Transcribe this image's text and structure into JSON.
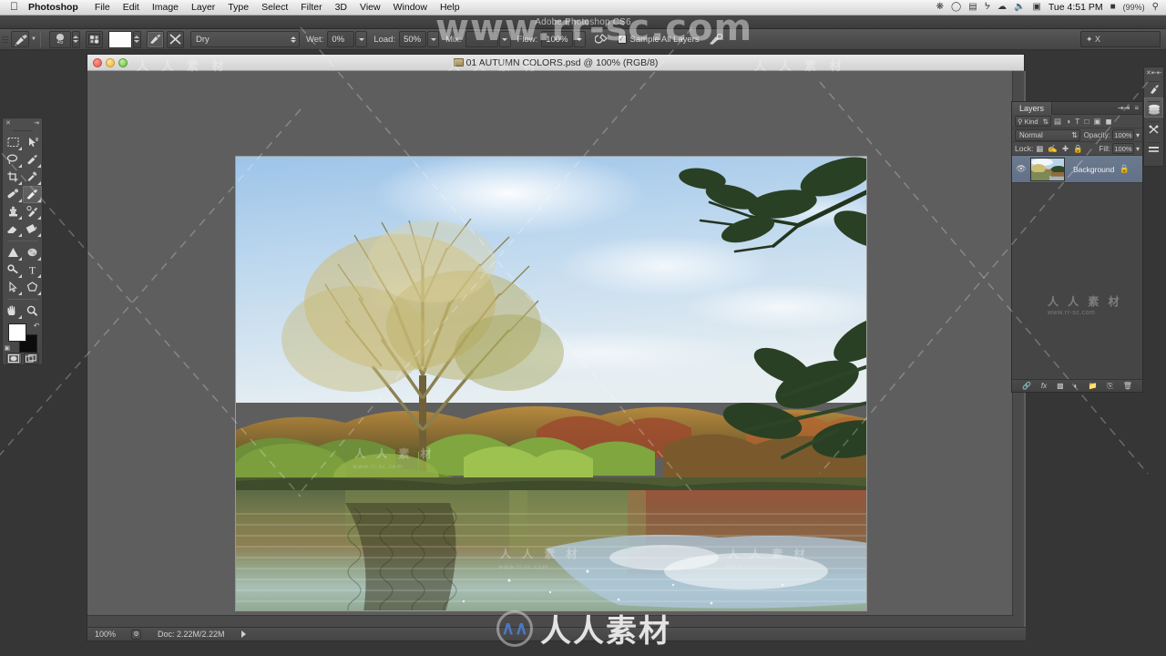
{
  "os_menubar": {
    "apple_icon": "apple-icon",
    "app_name": "Photoshop",
    "menus": [
      "File",
      "Edit",
      "Image",
      "Layer",
      "Type",
      "Select",
      "Filter",
      "3D",
      "View",
      "Window",
      "Help"
    ],
    "status_icons": [
      "spinner-icon",
      "clock-icon",
      "display-icon",
      "bluetooth-icon",
      "wifi-icon",
      "volume-icon",
      "airplay-icon"
    ],
    "clock": "Tue 4:51 PM",
    "battery": "(99%)",
    "search_icon": "search-icon"
  },
  "app": {
    "title": "Adobe Photoshop CS6"
  },
  "options_bar": {
    "tool_preset_icon": "mixer-brush-icon",
    "brush_size_label": "45",
    "brush_preset_icon": "brush-preset-icon",
    "load_swatch_color": "#fdfdfd",
    "clean_brush_icon": "clean-brush-icon",
    "load_brush_icon": "load-brush-icon",
    "preset_combo": "Dry",
    "wet_label": "Wet:",
    "wet_value": "0%",
    "load_label": "Load:",
    "load_value": "50%",
    "mix_label": "Mix:",
    "mix_value": "",
    "flow_label": "Flow:",
    "flow_value": "100%",
    "airbrush_icon": "airbrush-icon",
    "sample_all_layers_label": "Sample All Layers",
    "sample_all_layers_checked": "✓",
    "pressure_icon": "pressure-icon",
    "workspace_value": "✦ X"
  },
  "tools": {
    "column_left": [
      "marquee-rect-icon",
      "lasso-icon",
      "crop-icon",
      "eyedropper-icon",
      "clone-stamp-icon",
      "eraser-icon",
      "gradient-icon",
      "blur-icon",
      "path-selection-icon",
      "hand-icon"
    ],
    "column_right": [
      "move-icon",
      "quick-selection-icon",
      "healing-brush-icon",
      "mixer-brush-icon",
      "history-brush-icon",
      "paint-bucket-icon",
      "dodge-icon",
      "type-icon",
      "shape-icon",
      "zoom-icon"
    ],
    "selected": "mixer-brush-icon",
    "foreground_color": "#ffffff",
    "background_color": "#0c0c0c",
    "swap_icon": "swap-colors-icon",
    "default_icon": "default-colors-icon",
    "quickmask_icons": [
      "standard-mode-icon",
      "screen-mode-icon"
    ]
  },
  "document": {
    "title": "01 AUTUMN COLORS.psd @ 100% (RGB/8)",
    "file_icon": "psd-file-icon",
    "window_buttons": [
      "close-button",
      "minimize-button",
      "zoom-button"
    ],
    "status": {
      "zoom": "100%",
      "doc_label": "Doc: 2.22M/2.22M",
      "play_icon": "status-arrow-icon"
    }
  },
  "layers_panel": {
    "tab_label": "Layers",
    "collapse_icon": "collapse-icon",
    "menu_icon": "panel-menu-icon",
    "filter_label": "Kind",
    "filter_icon": "filter-kind-icon",
    "filter_type_icons": [
      "pixel-filter-icon",
      "adjustment-filter-icon",
      "type-filter-icon",
      "shape-filter-icon",
      "smartobject-filter-icon"
    ],
    "filter_toggle_icon": "filter-toggle-icon",
    "blend_mode": "Normal",
    "opacity_label": "Opacity:",
    "opacity_value": "100%",
    "lock_label": "Lock:",
    "lock_icons": [
      "lock-transparent-icon",
      "lock-image-icon",
      "lock-position-icon",
      "lock-all-icon"
    ],
    "fill_label": "Fill:",
    "fill_value": "100%",
    "layers": [
      {
        "name": "Background",
        "visible_icon": "eye-icon",
        "lock_icon": "lock-icon",
        "thumbnail": "autumn-photo-thumbnail"
      }
    ],
    "footer_icons": [
      "link-layers-icon",
      "layer-style-fx-icon",
      "layer-mask-icon",
      "adjustment-layer-icon",
      "new-group-icon",
      "new-layer-icon",
      "delete-layer-icon"
    ]
  },
  "right_dock": {
    "panels": [
      "color-panel-icon",
      "layers-panel-icon",
      "adjustments-panel-icon",
      "history-panel-icon"
    ],
    "active": "layers-panel-icon",
    "collapse_icon": "expand-panels-icon"
  },
  "watermarks": {
    "url": "www.rr-sc.com",
    "chinese": "人 人 素 材",
    "bottom_text": "人人素材",
    "bottom_url_small": "www.rr-sc.com",
    "logo": "rr-sc-logo-icon"
  }
}
